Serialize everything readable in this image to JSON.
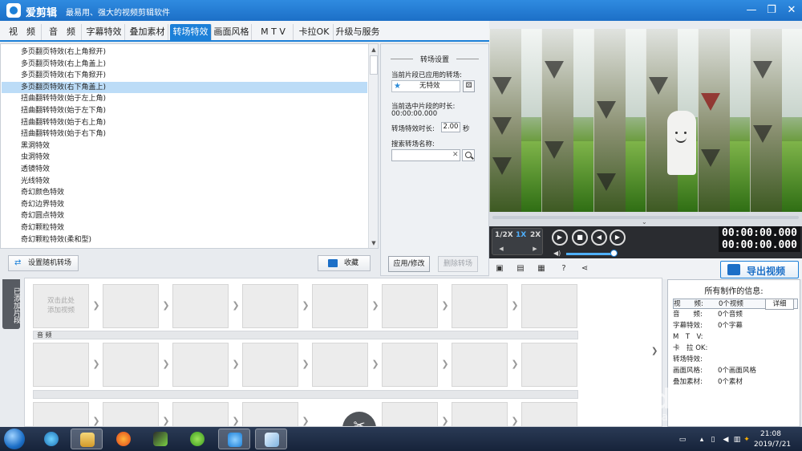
{
  "app": {
    "title": "爱剪辑",
    "slogan": "最易用、强大的视频剪辑软件",
    "accent_color": "#1c80d8"
  },
  "window_controls": {
    "minimize": "—",
    "maximize": "❐",
    "close": "✕"
  },
  "tabs": [
    {
      "label": "视　频"
    },
    {
      "label": "音　频"
    },
    {
      "label": "字幕特效"
    },
    {
      "label": "叠加素材"
    },
    {
      "label": "转场特效",
      "active": true
    },
    {
      "label": "画面风格"
    },
    {
      "label": "M T V"
    },
    {
      "label": "卡拉OK"
    },
    {
      "label": "升级与服务"
    }
  ],
  "effects_list": {
    "items": [
      "多页翻页特效(右上角掀开)",
      "多页翻页特效(右上角盖上)",
      "多页翻页特效(右下角掀开)",
      "多页翻页特效(右下角盖上)",
      "扭曲翻转特效(始于左上角)",
      "扭曲翻转特效(始于左下角)",
      "扭曲翻转特效(始于右上角)",
      "扭曲翻转特效(始于右下角)",
      "黑洞特效",
      "虫洞特效",
      "透镜特效",
      "光线特效",
      "奇幻颜色特效",
      "奇幻边界特效",
      "奇幻圆点特效",
      "奇幻颗粒特效",
      "奇幻颗粒特效(柔和型)"
    ],
    "selected_index": 3
  },
  "list_buttons": {
    "random": "设置随机转场",
    "collect": "收藏"
  },
  "settings": {
    "title": "转场设置",
    "applied_label": "当前片段已应用的转场:",
    "applied_value": "无特效",
    "duration_label": "当前选中片段的时长:",
    "duration_value": "00:00:00.000",
    "effect_duration_label": "转场特效时长:",
    "effect_duration_value": "2.00",
    "effect_duration_unit": "秒",
    "search_label": "搜索转场名称:",
    "search_value": "",
    "clear_glyph": "✕",
    "apply_button": "应用/修改",
    "delete_button": "删除转场"
  },
  "player": {
    "speeds": [
      "1/2X",
      "1X",
      "2X"
    ],
    "active_speed": "1X",
    "time_current": "00:00:00.000",
    "time_total": "00:00:00.000",
    "volume": 0.9
  },
  "export": {
    "label": "导出视频"
  },
  "timeline": {
    "side_tab": "已添加片段",
    "add_hint_line1": "双击此处",
    "add_hint_line2": "添加视频",
    "audio_track_label": "音 频"
  },
  "info_panel": {
    "title": "所有制作的信息:",
    "rows": [
      {
        "key": "视　　频:",
        "value": "0个视频"
      },
      {
        "key": "音　　频:",
        "value": "0个音频"
      },
      {
        "key": "字幕特效:",
        "value": "0个字幕"
      },
      {
        "key": "M　T　V:",
        "value": ""
      },
      {
        "key": "卡　拉 OK:",
        "value": ""
      },
      {
        "key": "转场特效:",
        "value": ""
      },
      {
        "key": "画面风格:",
        "value": "0个画面风格"
      },
      {
        "key": "叠加素材:",
        "value": "0个素材"
      }
    ],
    "detail_button": "详细"
  },
  "watermark": {
    "brand": "Baidu经验",
    "url": "jingyan.baidu.com"
  },
  "taskbar": {
    "time": "21:08",
    "date": "2019/7/21"
  }
}
